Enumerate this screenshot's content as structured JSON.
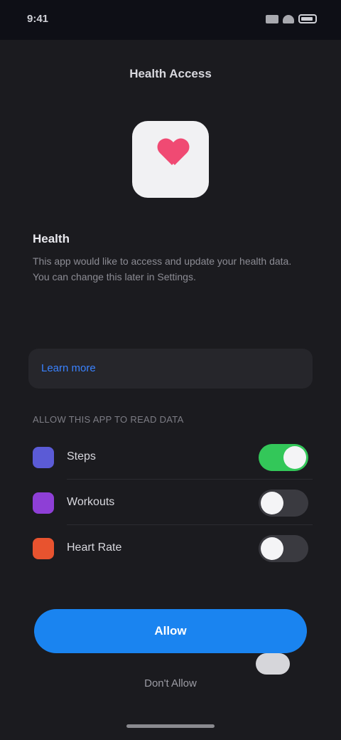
{
  "status_bar": {
    "time": "9:41",
    "icons": [
      "signal-icon",
      "wifi-icon",
      "battery-icon"
    ]
  },
  "sheet": {
    "title": "Health Access"
  },
  "app": {
    "icon": "heart-icon",
    "name": "Health",
    "description": "This app would like to access and update your health data. You can change this later in Settings."
  },
  "link_card": {
    "label": "Learn more"
  },
  "permissions": {
    "header": "ALLOW THIS APP TO READ DATA",
    "items": [
      {
        "label": "Steps",
        "icon": "steps-icon",
        "color": "#5b5bd6",
        "enabled": true
      },
      {
        "label": "Workouts",
        "icon": "workout-icon",
        "color": "#8e3fd6",
        "enabled": false
      },
      {
        "label": "Heart Rate",
        "icon": "heart-rate-icon",
        "color": "#e8532f",
        "enabled": false
      }
    ]
  },
  "actions": {
    "primary_label": "Allow",
    "secondary_label": "Don't Allow"
  },
  "colors": {
    "accent": "#1a84f0",
    "toggle_on": "#33c759",
    "background": "#1b1b1f"
  }
}
